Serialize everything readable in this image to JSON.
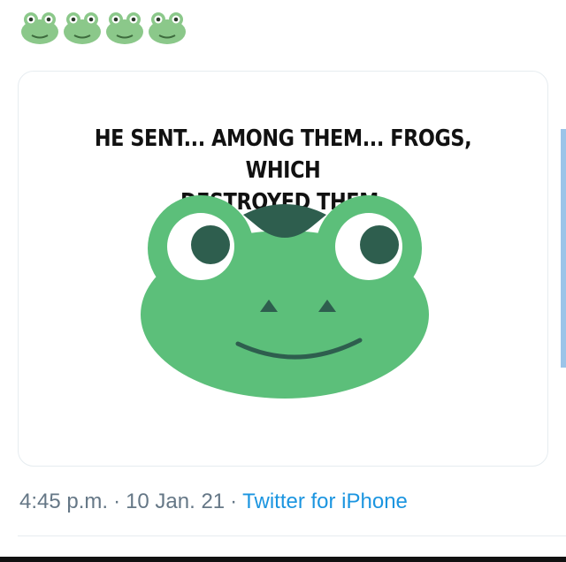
{
  "header": {
    "emoji_icons": [
      "frog-face-emoji",
      "frog-face-emoji",
      "frog-face-emoji",
      "frog-face-emoji"
    ]
  },
  "media": {
    "caption_line1": "HE SENT... AMONG THEM... FROGS, WHICH",
    "caption_line2": "DESTROYED THEM.",
    "image_icon": "frog-face-logo",
    "frog_color": "#5cbf7a",
    "frog_dark_color": "#2e5e4e"
  },
  "meta": {
    "time": "4:45 p.m.",
    "separator": "·",
    "date": "10 Jan. 21",
    "source": "Twitter for iPhone"
  },
  "colors": {
    "meta_text": "#657786",
    "link": "#1b95e0",
    "border": "#e6ecf0"
  }
}
